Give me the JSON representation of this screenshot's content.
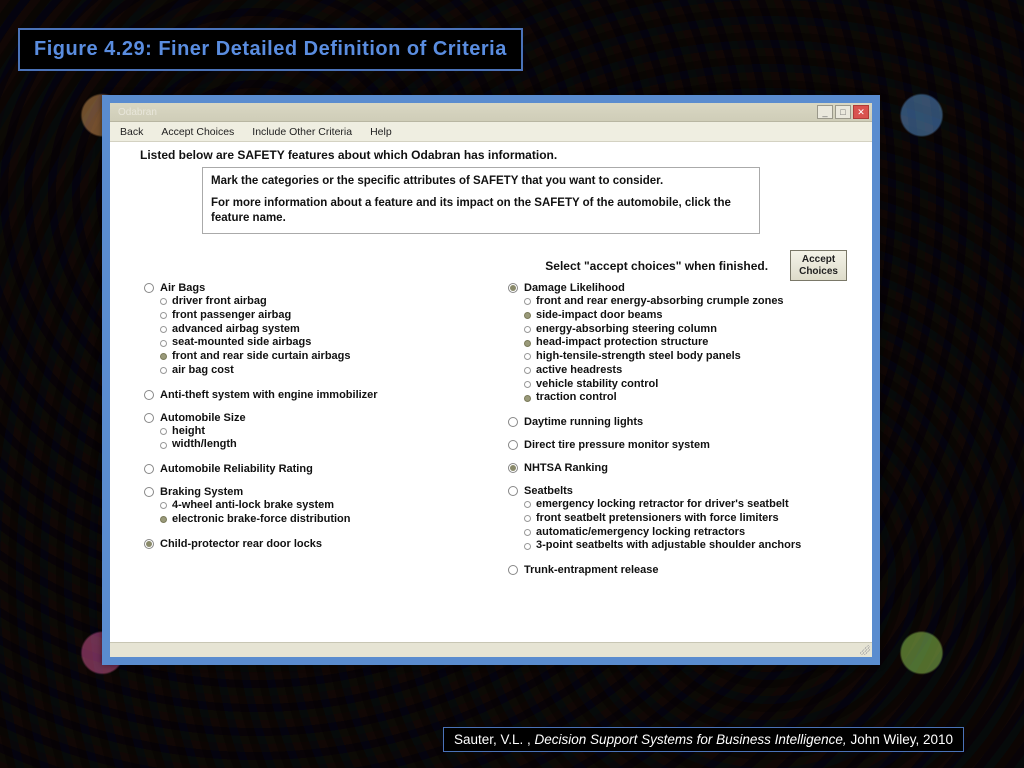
{
  "figure_title": "Figure 4.29:  Finer Detailed Definition of Criteria",
  "window": {
    "title": "Odabran",
    "menu": {
      "back": "Back",
      "accept": "Accept Choices",
      "include": "Include Other Criteria",
      "help": "Help"
    }
  },
  "intro": "Listed below are SAFETY features about which Odabran has information.",
  "instruction": {
    "p1": "Mark the categories or the specific attributes of SAFETY that you want to consider.",
    "p2": "For more information about a feature and its impact on the SAFETY of the automobile, click the feature name."
  },
  "accept_text": "Select \"accept choices\" when finished.",
  "accept_btn_l1": "Accept",
  "accept_btn_l2": "Choices",
  "col_left": [
    {
      "label": "Air Bags",
      "checked": false,
      "subs": [
        {
          "t": "driver front airbag",
          "on": false
        },
        {
          "t": "front passenger airbag",
          "on": false
        },
        {
          "t": "advanced airbag system",
          "on": false
        },
        {
          "t": "seat-mounted side airbags",
          "on": false
        },
        {
          "t": "front and rear side curtain airbags",
          "on": true
        },
        {
          "t": "air bag cost",
          "on": false
        }
      ]
    },
    {
      "label": "Anti-theft system with engine immobilizer",
      "checked": false,
      "subs": []
    },
    {
      "label": "Automobile Size",
      "checked": false,
      "subs": [
        {
          "t": "height",
          "on": false
        },
        {
          "t": "width/length",
          "on": false
        }
      ]
    },
    {
      "label": "Automobile Reliability Rating",
      "checked": false,
      "subs": []
    },
    {
      "label": "Braking System",
      "checked": false,
      "subs": [
        {
          "t": "4-wheel anti-lock brake system",
          "on": false
        },
        {
          "t": "electronic brake-force distribution",
          "on": true
        }
      ]
    },
    {
      "label": "Child-protector rear door locks",
      "checked": true,
      "subs": []
    }
  ],
  "col_right": [
    {
      "label": "Damage Likelihood",
      "checked": true,
      "subs": [
        {
          "t": "front and rear energy-absorbing crumple zones",
          "on": false
        },
        {
          "t": "side-impact door beams",
          "on": true
        },
        {
          "t": "energy-absorbing steering column",
          "on": false
        },
        {
          "t": "head-impact protection structure",
          "on": true
        },
        {
          "t": "high-tensile-strength steel body panels",
          "on": false
        },
        {
          "t": "active headrests",
          "on": false
        },
        {
          "t": "vehicle stability control",
          "on": false
        },
        {
          "t": "traction control",
          "on": true
        }
      ]
    },
    {
      "label": "Daytime running lights",
      "checked": false,
      "subs": []
    },
    {
      "label": "Direct tire pressure monitor system",
      "checked": false,
      "subs": []
    },
    {
      "label": "NHTSA Ranking",
      "checked": true,
      "subs": []
    },
    {
      "label": "Seatbelts",
      "checked": false,
      "subs": [
        {
          "t": "emergency locking retractor for driver's seatbelt",
          "on": false
        },
        {
          "t": "front seatbelt pretensioners with force limiters",
          "on": false
        },
        {
          "t": "automatic/emergency locking retractors",
          "on": false
        },
        {
          "t": "3-point seatbelts with adjustable shoulder anchors",
          "on": false
        }
      ]
    },
    {
      "label": "Trunk-entrapment release",
      "checked": false,
      "subs": []
    }
  ],
  "citation": {
    "author": "Sauter, V.L. , ",
    "title": "Decision Support Systems for Business Intelligence, ",
    "pub": "John Wiley, 2010"
  }
}
